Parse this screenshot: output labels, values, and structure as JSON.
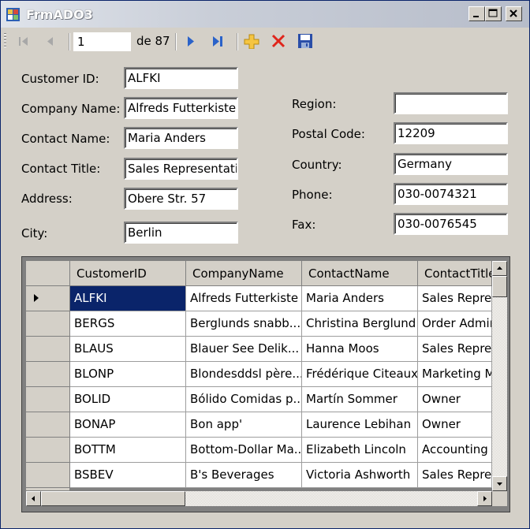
{
  "window": {
    "title": "FrmADO3"
  },
  "navigator": {
    "position": "1",
    "count_label": "de 87"
  },
  "form_left": [
    {
      "label": "Customer ID:",
      "value": "ALFKI"
    },
    {
      "label": "Company Name:",
      "value": "Alfreds Futterkiste"
    },
    {
      "label": "Contact Name:",
      "value": "Maria Anders"
    },
    {
      "label": "Contact Title:",
      "value": "Sales Representati"
    },
    {
      "label": "Address:",
      "value": "Obere Str. 57"
    },
    {
      "label": "City:",
      "value": "Berlin"
    }
  ],
  "form_right": [
    {
      "label": "Region:",
      "value": ""
    },
    {
      "label": "Postal Code:",
      "value": "12209"
    },
    {
      "label": "Country:",
      "value": "Germany"
    },
    {
      "label": "Phone:",
      "value": "030-0074321"
    },
    {
      "label": "Fax:",
      "value": "030-0076545"
    }
  ],
  "grid": {
    "columns": [
      "CustomerID",
      "CompanyName",
      "ContactName",
      "ContactTitle"
    ],
    "selected_row": 0,
    "rows": [
      [
        "ALFKI",
        "Alfreds Futterkiste",
        "Maria Anders",
        "Sales Repre"
      ],
      [
        "BERGS",
        "Berglunds snabb...",
        "Christina Berglund",
        "Order Admin"
      ],
      [
        "BLAUS",
        "Blauer See Delik...",
        "Hanna Moos",
        "Sales Repre"
      ],
      [
        "BLONP",
        "Blondesddsl père...",
        "Frédérique Citeaux",
        "Marketing M"
      ],
      [
        "BOLID",
        "Bólido Comidas p...",
        "Martín Sommer",
        "Owner"
      ],
      [
        "BONAP",
        "Bon app'",
        "Laurence Lebihan",
        "Owner"
      ],
      [
        "BOTTM",
        "Bottom-Dollar Ma...",
        "Elizabeth Lincoln",
        "Accounting I"
      ],
      [
        "BSBEV",
        "B's Beverages",
        "Victoria Ashworth",
        "Sales Repre"
      ]
    ]
  },
  "colors": {
    "selection": "#0a246a",
    "window_bg": "#d4d0c8"
  },
  "icons": [
    "move-first-icon",
    "move-previous-icon",
    "move-next-icon",
    "move-last-icon",
    "add-new-icon",
    "delete-icon",
    "save-icon"
  ]
}
